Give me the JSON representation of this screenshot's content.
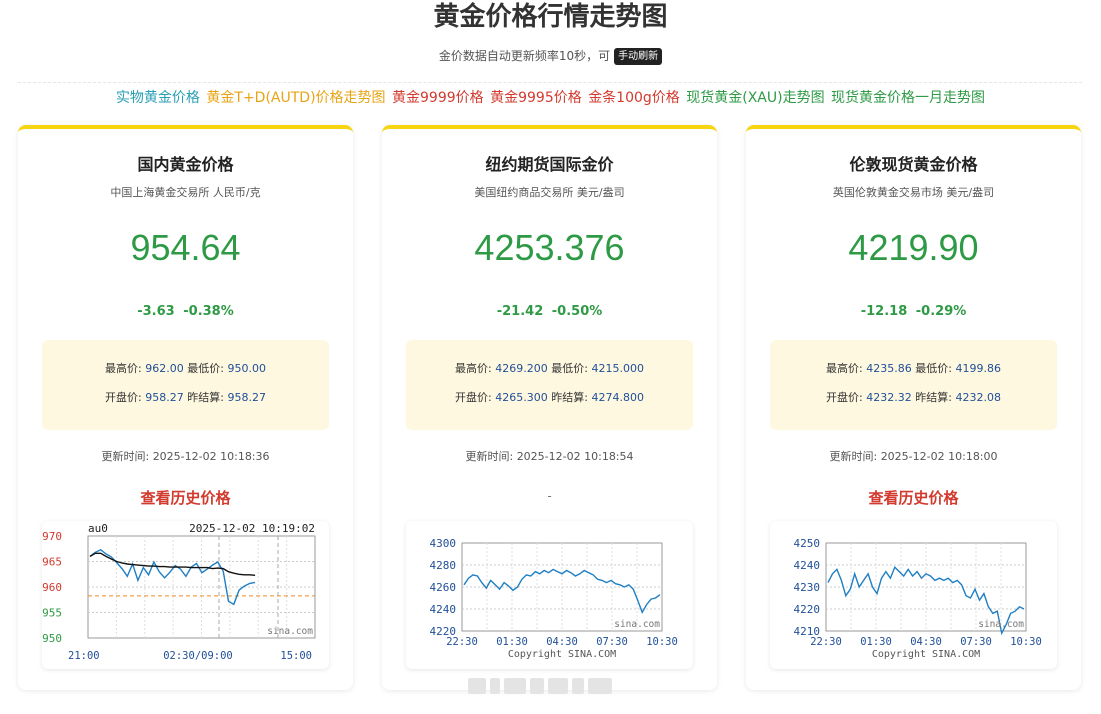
{
  "header": {
    "title": "黄金价格行情走势图",
    "subtitle": "金价数据自动更新频率10秒，可",
    "refresh_label": "手动刷新"
  },
  "links": [
    {
      "label": "实物黄金价格",
      "color": "#2a9fb3"
    },
    {
      "label": "黄金T+D(AUTD)价格走势图",
      "color": "#e8a415"
    },
    {
      "label": "黄金9999价格",
      "color": "#d23a2e"
    },
    {
      "label": "黄金9995价格",
      "color": "#d23a2e"
    },
    {
      "label": "金条100g价格",
      "color": "#d23a2e"
    },
    {
      "label": "现货黄金(XAU)走势图",
      "color": "#2e9a45"
    },
    {
      "label": "现货黄金价格一月走势图",
      "color": "#2e9a45"
    }
  ],
  "colors": {
    "accent": "#f6d40f",
    "down": "#2e9a45",
    "link_red": "#d23a2e",
    "stats_bg": "#fff8e0"
  },
  "cards": [
    {
      "title": "国内黄金价格",
      "source": "中国上海黄金交易所 人民币/克",
      "price": "954.64",
      "change": "-3.63",
      "change_pct": "-0.38%",
      "high_label": "最高价:",
      "high": "962.00",
      "low_label": "最低价:",
      "low": "950.00",
      "open_label": "开盘价:",
      "open": "958.27",
      "prev_label": "昨结算:",
      "prev": "958.27",
      "update_label": "更新时间:",
      "update_time": "2025-12-02 10:18:36",
      "history_label": "查看历史价格"
    },
    {
      "title": "纽约期货国际金价",
      "source": "美国纽约商品交易所 美元/盎司",
      "price": "4253.376",
      "change": "-21.42",
      "change_pct": "-0.50%",
      "high_label": "最高价:",
      "high": "4269.200",
      "low_label": "最低价:",
      "low": "4215.000",
      "open_label": "开盘价:",
      "open": "4265.300",
      "prev_label": "昨结算:",
      "prev": "4274.800",
      "update_label": "更新时间:",
      "update_time": "2025-12-02 10:18:54",
      "history_label": "-"
    },
    {
      "title": "伦敦现货黄金价格",
      "source": "英国伦敦黄金交易市场 美元/盎司",
      "price": "4219.90",
      "change": "-12.18",
      "change_pct": "-0.29%",
      "high_label": "最高价:",
      "high": "4235.86",
      "low_label": "最低价:",
      "low": "4199.86",
      "open_label": "开盘价:",
      "open": "4232.32",
      "prev_label": "昨结算:",
      "prev": "4232.08",
      "update_label": "更新时间:",
      "update_time": "2025-12-02 10:18:00",
      "history_label": "查看历史价格"
    }
  ],
  "chart_data": [
    {
      "type": "line",
      "symbol": "au0",
      "timestamp": "2025-12-02  10:19:02",
      "ylim": [
        950,
        970
      ],
      "yticks": [
        "970",
        "965",
        "960",
        "955",
        "950"
      ],
      "xticks": [
        "21:00",
        "02:30/09:00",
        "15:00"
      ],
      "prev_settle": 958.27,
      "watermark": "sina.com",
      "series": [
        {
          "values": [
            966.0,
            966.8,
            967.3,
            966.5,
            965.9,
            964.8,
            963.6,
            962.1,
            964.5,
            961.3,
            963.8,
            962.4,
            964.9,
            963.0,
            961.8,
            962.9,
            964.2,
            963.5,
            962.1,
            963.9,
            964.6,
            962.8,
            963.5,
            964.3,
            964.9,
            963.1,
            957.2,
            956.6,
            959.4,
            960.2,
            960.7,
            960.9
          ]
        },
        {
          "values": [
            966.0,
            966.6,
            966.6,
            966.0,
            965.5,
            965.0,
            964.7,
            964.5,
            964.4,
            964.3,
            964.2,
            964.1,
            964.1,
            964.0,
            964.0,
            963.9,
            963.9,
            963.9,
            963.9,
            963.8,
            963.8,
            963.8,
            963.8,
            963.6,
            963.7,
            963.6,
            963.0,
            962.7,
            962.5,
            962.4,
            962.4,
            962.3
          ]
        }
      ]
    },
    {
      "type": "line",
      "ylim": [
        4220,
        4300
      ],
      "yticks": [
        "4300",
        "4280",
        "4260",
        "4240",
        "4220"
      ],
      "xticks": [
        "22:30",
        "01:30",
        "04:30",
        "07:30",
        "10:30"
      ],
      "footer": "Copyright  SINA.COM",
      "watermark": "sina.com",
      "series": [
        {
          "values": [
            4262,
            4268,
            4271,
            4270,
            4264,
            4259,
            4266,
            4262,
            4258,
            4264,
            4261,
            4257,
            4260,
            4267,
            4271,
            4270,
            4274,
            4272,
            4275,
            4273,
            4276,
            4274,
            4272,
            4275,
            4273,
            4270,
            4272,
            4275,
            4273,
            4271,
            4267,
            4266,
            4264,
            4266,
            4263,
            4262,
            4260,
            4262,
            4258,
            4248,
            4237,
            4244,
            4249,
            4250,
            4253
          ]
        }
      ]
    },
    {
      "type": "line",
      "ylim": [
        4210,
        4250
      ],
      "yticks": [
        "4250",
        "4240",
        "4230",
        "4220",
        "4210"
      ],
      "xticks": [
        "22:30",
        "01:30",
        "04:30",
        "07:30",
        "10:30"
      ],
      "footer": "Copyright  SINA.COM",
      "watermark": "sina.com",
      "series": [
        {
          "values": [
            4232,
            4236,
            4238,
            4233,
            4226,
            4229,
            4236,
            4230,
            4233,
            4236,
            4230,
            4227,
            4234,
            4237,
            4234,
            4239,
            4237,
            4235,
            4238,
            4235,
            4237,
            4234,
            4236,
            4235,
            4233,
            4234,
            4233,
            4234,
            4232,
            4233,
            4231,
            4226,
            4225,
            4229,
            4224,
            4227,
            4221,
            4218,
            4219,
            4209,
            4213,
            4218,
            4219,
            4221,
            4220
          ]
        }
      ]
    }
  ]
}
